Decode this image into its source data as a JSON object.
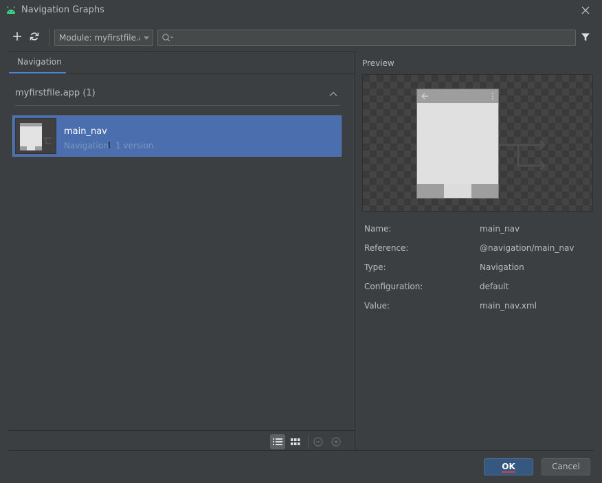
{
  "window": {
    "title": "Navigation Graphs",
    "app_icon": "android-icon",
    "close_icon": "close-icon"
  },
  "toolbar": {
    "add_icon": "plus-icon",
    "refresh_icon": "refresh-icon",
    "module_selected": "Module: myfirstfile.app",
    "search_value": "",
    "search_icon": "search-icon",
    "filter_icon": "filter-icon"
  },
  "tabs": [
    {
      "label": "Navigation",
      "active": true
    }
  ],
  "group": {
    "title": "myfirstfile.app",
    "count": "(1)",
    "collapse_icon": "chevron-up-icon"
  },
  "resources": [
    {
      "name": "main_nav",
      "type": "Navigation",
      "versions": "1 version",
      "selected": true
    }
  ],
  "view_controls": {
    "list_icon": "list-view-icon",
    "grid_icon": "grid-view-icon",
    "zoom_out_icon": "zoom-out-icon",
    "zoom_in_icon": "zoom-in-icon"
  },
  "preview": {
    "label": "Preview"
  },
  "properties": [
    {
      "key": "Name:",
      "value": "main_nav"
    },
    {
      "key": "Reference:",
      "value": "@navigation/main_nav"
    },
    {
      "key": "Type:",
      "value": "Navigation"
    },
    {
      "key": "Configuration:",
      "value": "default"
    },
    {
      "key": "Value:",
      "value": "main_nav.xml"
    }
  ],
  "buttons": {
    "ok": "OK",
    "cancel": "Cancel"
  },
  "colors": {
    "background": "#3c3f41",
    "selection": "#4b6eaf",
    "accent": "#4a88c7",
    "ok_button": "#365880"
  }
}
